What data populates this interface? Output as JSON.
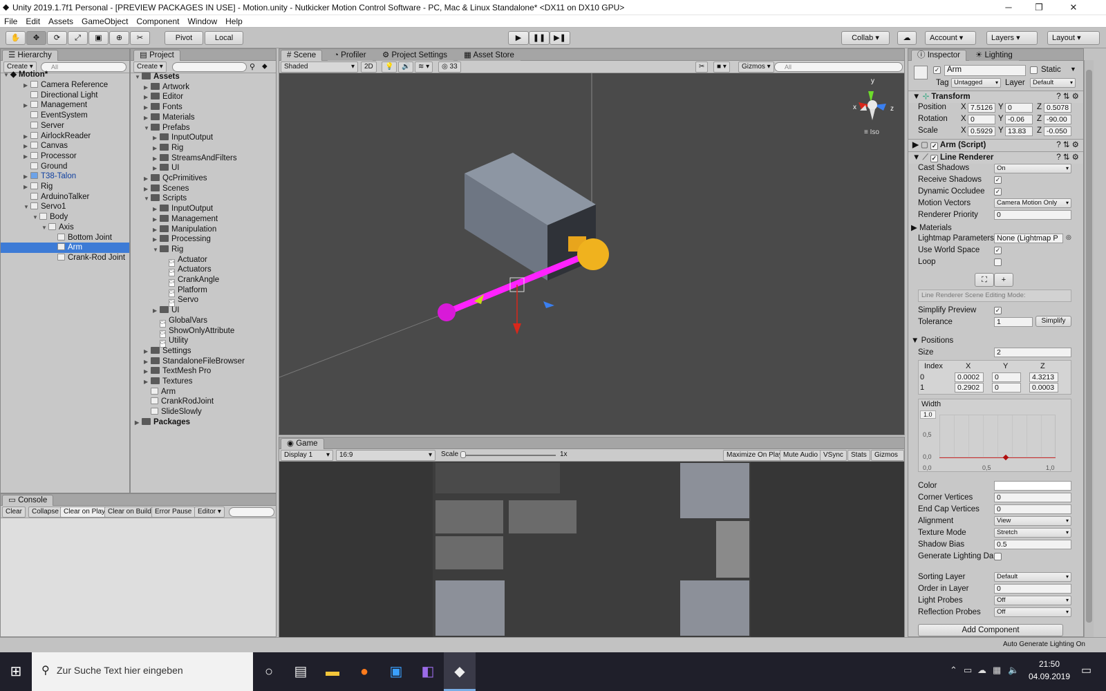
{
  "window": {
    "title": "Unity 2019.1.7f1 Personal - [PREVIEW PACKAGES IN USE] - Motion.unity - Nutkicker Motion Control Software - PC, Mac & Linux Standalone* <DX11 on DX10 GPU>",
    "minimize": "─",
    "maximize": "❐",
    "close": "✕"
  },
  "menu": [
    "File",
    "Edit",
    "Assets",
    "GameObject",
    "Component",
    "Window",
    "Help"
  ],
  "toolbar": {
    "pivot": "Pivot",
    "local": "Local",
    "collab": "Collab ▾",
    "account": "Account",
    "layers": "Layers",
    "layout": "Layout"
  },
  "hierarchy": {
    "tab": "Hierarchy",
    "create": "Create",
    "search": "All",
    "scene": "Motion*",
    "items": [
      "Camera Reference",
      "Directional Light",
      "Management",
      "EventSystem",
      "Server",
      "AirlockReader",
      "Canvas",
      "Processor",
      "Ground",
      "T38-Talon",
      "Rig",
      "ArduinoTalker",
      "Servo1",
      "Body",
      "Axis",
      "Bottom Joint",
      "Arm",
      "Crank-Rod Joint"
    ]
  },
  "project": {
    "tab": "Project",
    "create": "Create",
    "items": [
      "Assets",
      "Artwork",
      "Editor",
      "Fonts",
      "Materials",
      "Prefabs",
      "InputOutput",
      "Rig",
      "StreamsAndFilters",
      "UI",
      "QcPrimitives",
      "Scenes",
      "Scripts",
      "InputOutput",
      "Management",
      "Manipulation",
      "Processing",
      "Rig",
      "Actuator",
      "Actuators",
      "CrankAngle",
      "Platform",
      "Servo",
      "UI",
      "GlobalVars",
      "ShowOnlyAttribute",
      "Utility",
      "Settings",
      "StandaloneFileBrowser",
      "TextMesh Pro",
      "Textures",
      "Arm",
      "CrankRodJoint",
      "SlideSlowly",
      "Packages"
    ]
  },
  "scene": {
    "tabs": [
      "Scene",
      "Profiler",
      "Project Settings",
      "Asset Store"
    ],
    "shading": "Shaded",
    "mode2d": "2D",
    "count": "33",
    "gizmos": "Gizmos",
    "search": "All",
    "iso": "≡ Iso",
    "axis_x": "x",
    "axis_y": "y",
    "axis_z": "z"
  },
  "game": {
    "tab": "Game",
    "display": "Display 1",
    "aspect": "16:9",
    "scale_label": "Scale",
    "scale_value": "1x",
    "buttons": [
      "Maximize On Play",
      "Mute Audio",
      "VSync",
      "Stats",
      "Gizmos"
    ]
  },
  "console": {
    "tab": "Console",
    "buttons": [
      "Clear",
      "Collapse",
      "Clear on Play",
      "Clear on Build",
      "Error Pause",
      "Editor"
    ]
  },
  "inspector": {
    "tab": "Inspector",
    "tab2": "Lighting",
    "name": "Arm",
    "static": "Static",
    "tag_label": "Tag",
    "tag": "Untagged",
    "layer_label": "Layer",
    "layer": "Default",
    "transform": {
      "title": "Transform",
      "position": {
        "label": "Position",
        "x": "7.5126",
        "y": "0",
        "z": "0.5078"
      },
      "rotation": {
        "label": "Rotation",
        "x": "0",
        "y": "-0.06",
        "z": "-90.00"
      },
      "scale": {
        "label": "Scale",
        "x": "0.5929",
        "y": "13.83",
        "z": "-0.050"
      }
    },
    "arm_script": "Arm (Script)",
    "line_renderer": "Line Renderer",
    "lr": {
      "cast_shadows": "Cast Shadows",
      "cast_shadows_v": "On",
      "receive_shadows": "Receive Shadows",
      "dynamic_occludee": "Dynamic Occludee",
      "motion_vectors": "Motion Vectors",
      "motion_vectors_v": "Camera Motion Only",
      "renderer_priority": "Renderer Priority",
      "renderer_priority_v": "0",
      "materials": "Materials",
      "lightmap": "Lightmap Parameters",
      "lightmap_v": "None (Lightmap P",
      "world_space": "Use World Space",
      "loop": "Loop",
      "edit_mode": "Line Renderer Scene Editing Mode:",
      "simplify_preview": "Simplify Preview",
      "tolerance": "Tolerance",
      "tolerance_v": "1",
      "simplify": "Simplify",
      "positions": "Positions",
      "size": "Size",
      "size_v": "2",
      "pos_headers": [
        "Index",
        "X",
        "Y",
        "Z"
      ],
      "pos_rows": [
        [
          "0",
          "0.0002",
          "0",
          "4.3213"
        ],
        [
          "1",
          "0.2902",
          "0",
          "0.0003"
        ]
      ],
      "width": "Width",
      "width_ticks_y": [
        "1,0",
        "0,5",
        "0,0"
      ],
      "width_ticks_x": [
        "0,0",
        "0,5",
        "1,0"
      ],
      "width_top": "1.0",
      "color": "Color",
      "corner": "Corner Vertices",
      "corner_v": "0",
      "endcap": "End Cap Vertices",
      "endcap_v": "0",
      "alignment": "Alignment",
      "alignment_v": "View",
      "texture_mode": "Texture Mode",
      "texture_mode_v": "Stretch",
      "shadow_bias": "Shadow Bias",
      "shadow_bias_v": "0.5",
      "gen_lighting": "Generate Lighting Da",
      "sorting_layer": "Sorting Layer",
      "sorting_layer_v": "Default",
      "order": "Order in Layer",
      "order_v": "0",
      "light_probes": "Light Probes",
      "light_probes_v": "Off",
      "reflection_probes": "Reflection Probes",
      "reflection_probes_v": "Off"
    },
    "add_component": "Add Component"
  },
  "status": {
    "right": "Auto Generate Lighting On"
  },
  "taskbar": {
    "search": "Zur Suche Text hier eingeben",
    "time": "21:50",
    "date": "04.09.2019"
  }
}
